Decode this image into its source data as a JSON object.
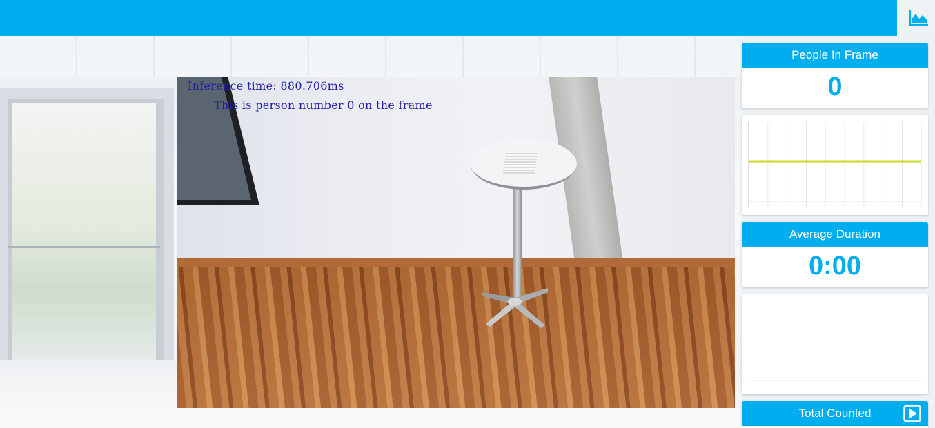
{
  "header": {
    "stats_icon": "area-chart-icon",
    "accent": "#00aeef"
  },
  "video": {
    "overlay_lines": [
      "Inference time: 880.706ms",
      "This is person number 0 on the frame"
    ],
    "overlay_color": "#1f1fa8"
  },
  "panel": {
    "people_in_frame": {
      "label": "People In Frame",
      "value": "0"
    },
    "people_chart": {
      "line_color": "#c6d82a",
      "gridlines": 9
    },
    "average_duration": {
      "label": "Average Duration",
      "value": "0:00"
    },
    "total_counted": {
      "label": "Total Counted",
      "action_icon": "play-icon"
    }
  }
}
